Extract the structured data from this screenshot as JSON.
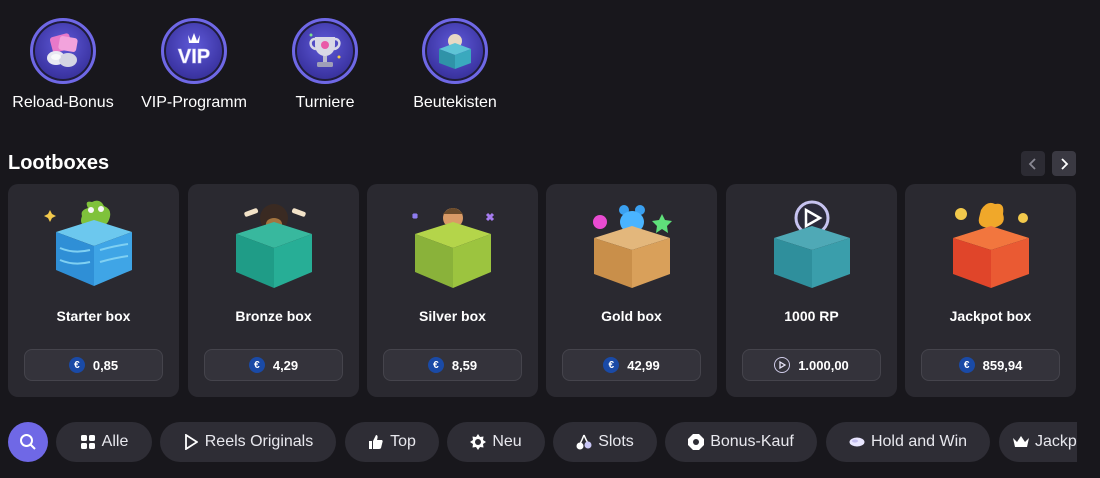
{
  "quick_nav": [
    {
      "label": "Reload-Bonus",
      "icon": "reload-bonus-icon"
    },
    {
      "label": "VIP-Programm",
      "icon": "vip-icon",
      "icon_text": "VIP"
    },
    {
      "label": "Turniere",
      "icon": "trophy-icon"
    },
    {
      "label": "Beutekisten",
      "icon": "loot-chest-icon"
    }
  ],
  "lootboxes": {
    "title": "Lootboxes",
    "prev_icon": "chevron-left-icon",
    "next_icon": "chevron-right-icon",
    "cards": [
      {
        "name": "Starter box",
        "price": "0,85",
        "currency": "€",
        "color": "#2f8fd6",
        "mascot": "frog"
      },
      {
        "name": "Bronze box",
        "price": "4,29",
        "currency": "€",
        "color": "#1f9c87",
        "mascot": "dog"
      },
      {
        "name": "Silver box",
        "price": "8,59",
        "currency": "€",
        "color": "#8ab23a",
        "mascot": "viking"
      },
      {
        "name": "Gold box",
        "price": "42,99",
        "currency": "€",
        "color": "#c98f4a",
        "mascot": "gummy-bear"
      },
      {
        "name": "1000 RP",
        "price": "1.000,00",
        "currency": "RP",
        "color": "#2f8f9c",
        "mascot": "reels-points"
      },
      {
        "name": "Jackpot box",
        "price": "859,94",
        "currency": "€",
        "color": "#e0452a",
        "mascot": "gold-frog"
      }
    ]
  },
  "filters": {
    "search_icon": "search-icon",
    "chips": [
      {
        "label": "Alle",
        "icon": "grid-icon"
      },
      {
        "label": "Reels Originals",
        "icon": "reels-logo-icon"
      },
      {
        "label": "Top",
        "icon": "thumbs-up-icon"
      },
      {
        "label": "Neu",
        "icon": "new-badge-icon"
      },
      {
        "label": "Slots",
        "icon": "cherries-icon"
      },
      {
        "label": "Bonus-Kauf",
        "icon": "bonus-buy-icon"
      },
      {
        "label": "Hold and Win",
        "icon": "coins-icon"
      },
      {
        "label": "Jackpot",
        "icon": "crown-icon"
      }
    ]
  },
  "colors": {
    "background": "#18171c",
    "card": "#2a2930",
    "accent": "#6f68e6",
    "chip": "#2e2d35"
  }
}
